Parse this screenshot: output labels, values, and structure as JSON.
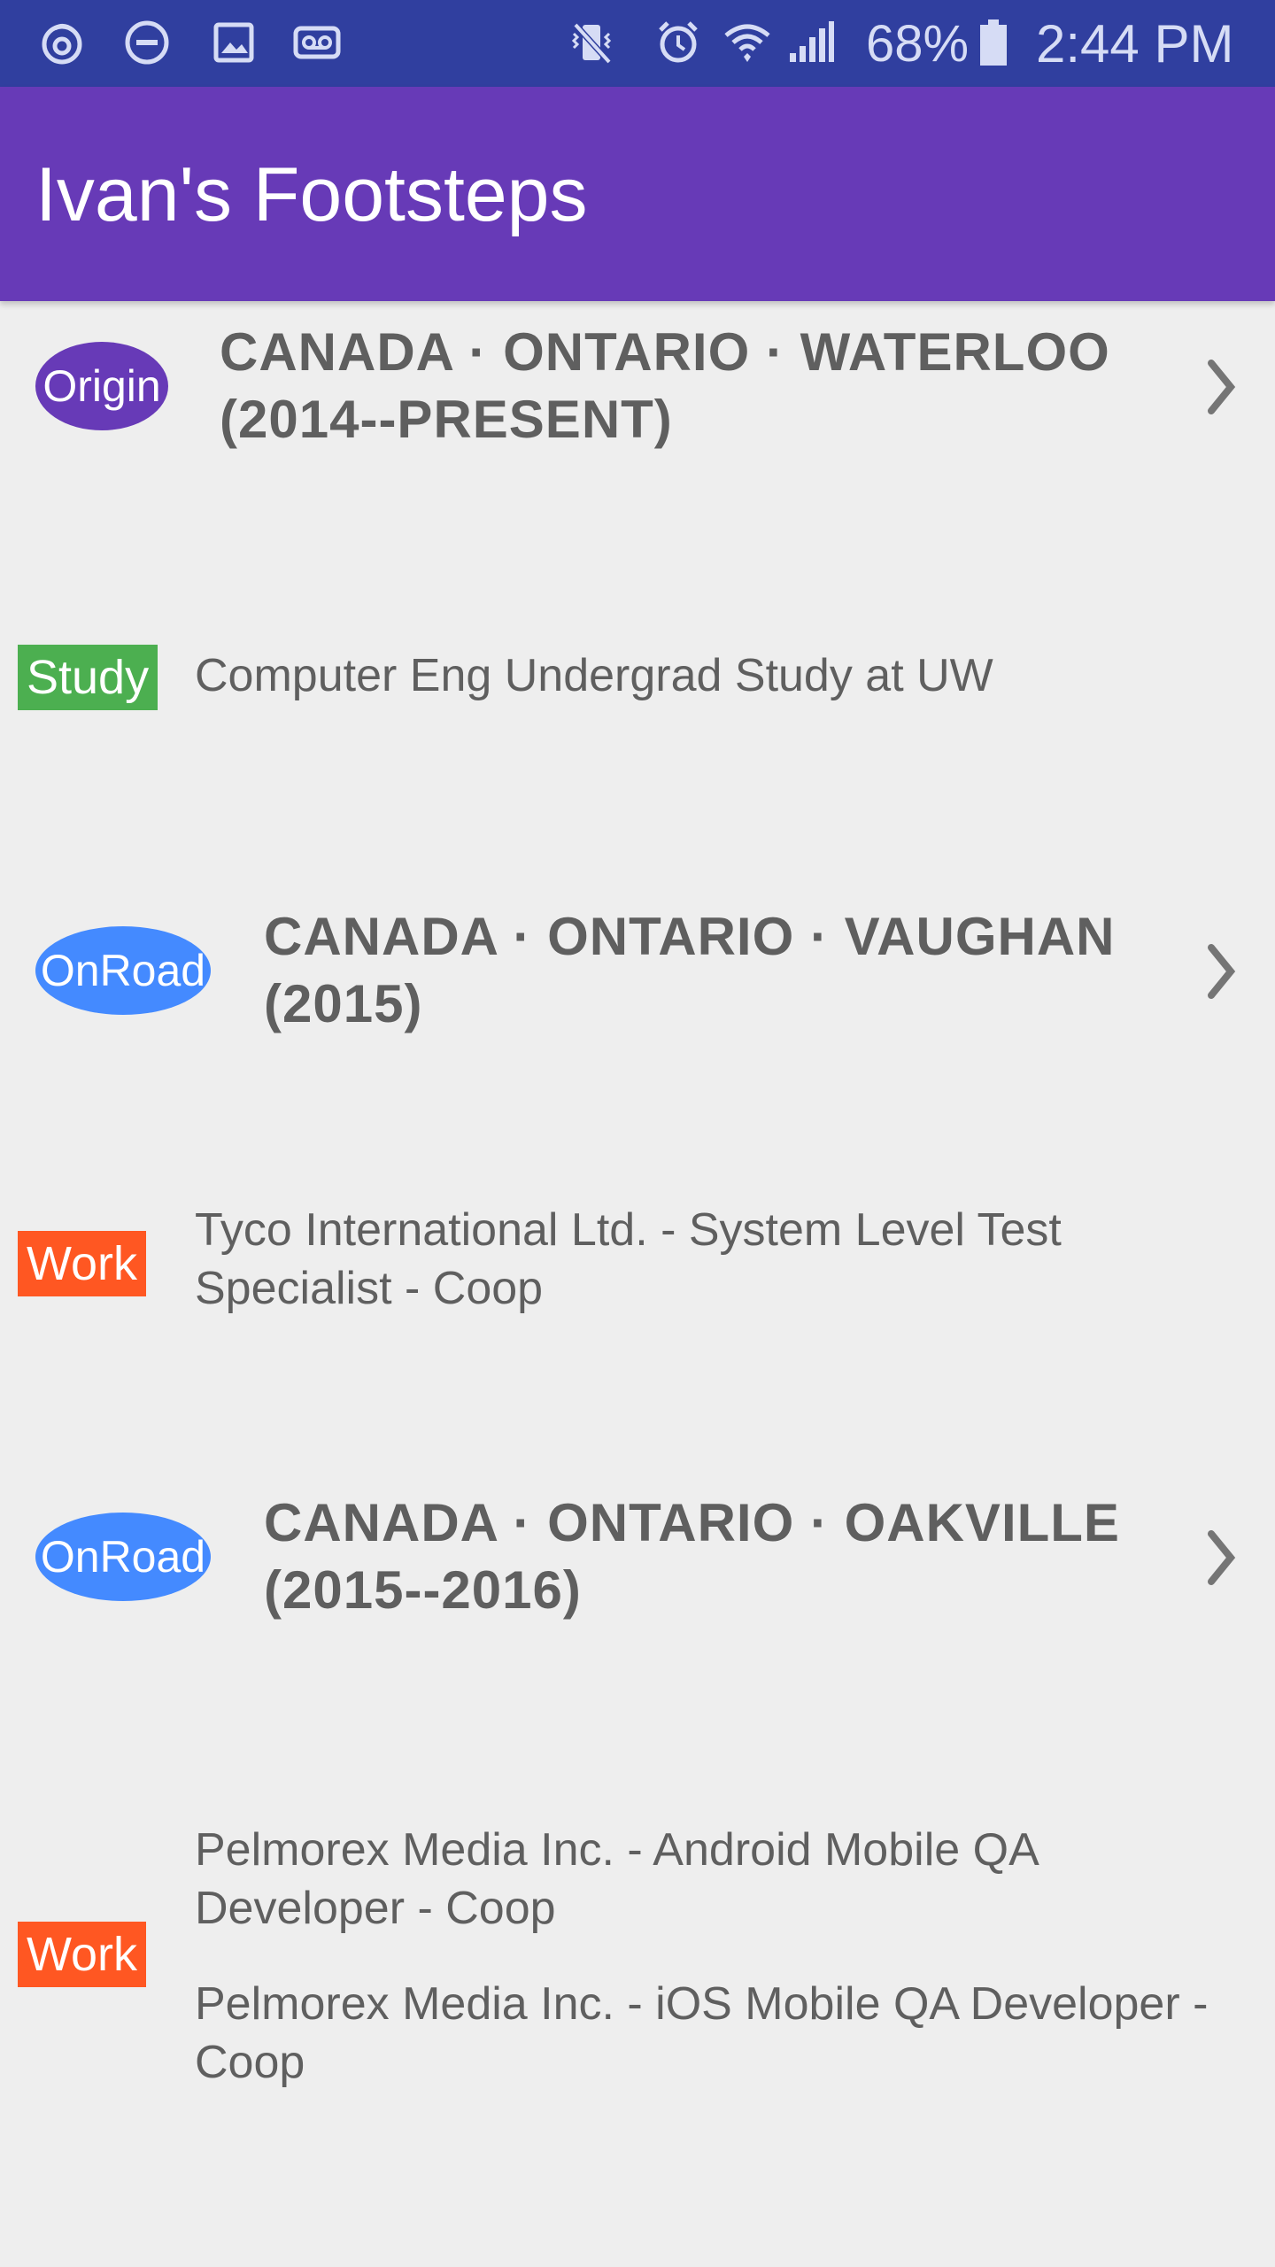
{
  "status_bar": {
    "battery_percent": "68%",
    "time": "2:44 PM",
    "icons": [
      "notification-swirl-icon",
      "do-not-disturb-icon",
      "image-icon",
      "voicemail-icon",
      "vibrate-mute-icon",
      "alarm-icon",
      "wifi-icon",
      "signal-icon",
      "battery-icon"
    ]
  },
  "app_bar": {
    "title": "Ivan's Footsteps"
  },
  "list": [
    {
      "type": "location",
      "badge": "Origin",
      "badge_color": "#673ab7",
      "line1": "CANADA · ONTARIO · WATERLOO",
      "line2": "(2014--PRESENT)"
    },
    {
      "type": "activity",
      "tag": "Study",
      "tag_color": "#4caf50",
      "entries": [
        "Computer Eng Undergrad Study at UW"
      ]
    },
    {
      "type": "location",
      "badge": "OnRoad",
      "badge_color": "#448aff",
      "line1": "CANADA · ONTARIO · VAUGHAN",
      "line2": "(2015)"
    },
    {
      "type": "activity",
      "tag": "Work",
      "tag_color": "#ff5722",
      "entries": [
        "Tyco International Ltd. - System Level Test Specialist - Coop"
      ]
    },
    {
      "type": "location",
      "badge": "OnRoad",
      "badge_color": "#448aff",
      "line1": "CANADA · ONTARIO · OAKVILLE",
      "line2": "(2015--2016)"
    },
    {
      "type": "activity",
      "tag": "Work",
      "tag_color": "#ff5722",
      "entries": [
        "Pelmorex Media Inc. - Android Mobile QA Developer - Coop",
        "Pelmorex Media Inc. - iOS Mobile QA Developer - Coop"
      ]
    }
  ]
}
